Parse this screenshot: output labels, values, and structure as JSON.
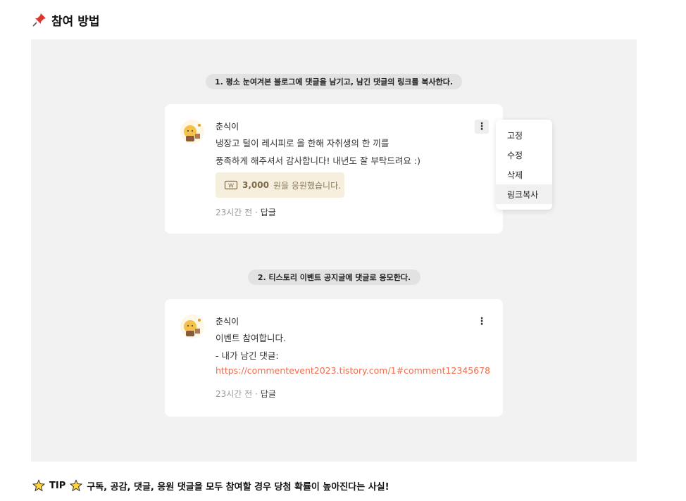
{
  "title": {
    "text": "참여 방법",
    "icon": "pushpin-icon"
  },
  "steps": {
    "step1": "1. 평소 눈여겨본 블로그에 댓글을 남기고, 남긴 댓글의 링크를 복사한다.",
    "step2": "2. 티스토리 이벤트 공지글에 댓글로 응모한다."
  },
  "comment1": {
    "author": "춘식이",
    "lines": [
      "냉장고 털이 레시피로 올 한해 자취생의 한 끼를",
      "풍족하게 해주셔서 감사합니다! 내년도 잘 부탁드려요 :)"
    ],
    "donation": {
      "amount": "3,000",
      "text": "원을 응원했습니다."
    },
    "time": "23시간 전",
    "separator": "·",
    "reply": "답글",
    "more": "⋮"
  },
  "context_menu": {
    "items": [
      "고정",
      "수정",
      "삭제",
      "링크복사"
    ],
    "highlighted": "링크복사"
  },
  "comment2": {
    "author": "춘식이",
    "lines": [
      "이벤트 참여합니다.",
      "- 내가 남긴 댓글:"
    ],
    "link": "https://commentevent2023.tistory.com/1#comment12345678",
    "time": "23시간 전",
    "separator": "·",
    "reply": "답글",
    "more": "⋮"
  },
  "tip": {
    "label": "TIP",
    "text": "구독, 공감, 댓글, 응원 댓글을 모두 참여할 경우 당첨 확률이 높아진다는 사실!",
    "icon": "star-icon"
  },
  "colors": {
    "panel": "#f2f2f2",
    "link": "#f26a4b",
    "donation_bg": "#f6efdd"
  }
}
